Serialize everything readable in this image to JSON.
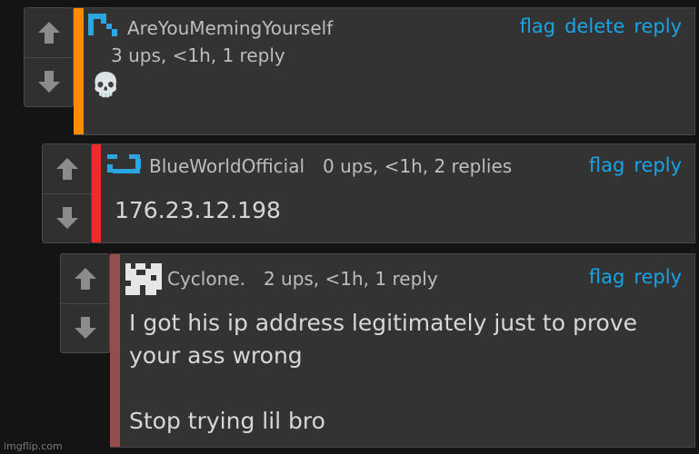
{
  "comments": [
    {
      "username": "AreYouMemingYourself",
      "meta": "3 ups, <1h, 1 reply",
      "actions": {
        "flag": "flag",
        "delete": "delete",
        "reply": "reply"
      },
      "body": "💀",
      "avatar_icon": "blue-pixel-glyph-icon",
      "accent_color": "#ff8c00"
    },
    {
      "username": "BlueWorldOfficial",
      "meta": "0 ups, <1h, 2 replies",
      "actions": {
        "flag": "flag",
        "reply": "reply"
      },
      "body": "176.23.12.198",
      "avatar_icon": "blue-pixel-glyph-icon",
      "accent_color": "#ee2a2a"
    },
    {
      "username": "Cyclone.",
      "meta": "2 ups, <1h, 1 reply",
      "actions": {
        "flag": "flag",
        "reply": "reply"
      },
      "body": "I got his ip address legitimately just to prove\nyour ass wrong\n\nStop trying lil bro",
      "avatar_icon": "white-pixel-glyph-icon",
      "accent_color": "#9a4b4b"
    }
  ],
  "vote_icons": {
    "up": "arrow-up-icon",
    "down": "arrow-down-icon"
  },
  "watermark": "imgflip.com",
  "colors": {
    "link": "#1aa3e6",
    "background": "#141414",
    "panel": "#333333"
  }
}
